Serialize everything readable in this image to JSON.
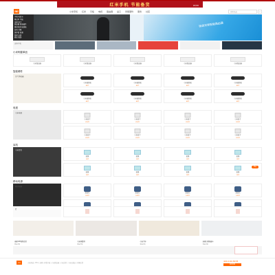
{
  "top": {
    "promo_title": "红米手机 节能备货",
    "promo_sub": "限时抢购"
  },
  "header": {
    "logo": "mi",
    "nav": [
      "小米手机",
      "红米",
      "平板",
      "电视",
      "路由器",
      "盒子",
      "智能硬件",
      "服务",
      "社区"
    ],
    "search_placeholder": "搜索商品",
    "search_icon": "search-icon"
  },
  "hero": {
    "categories": [
      "手机 电话卡",
      "笔记本 平板",
      "电视 盒子",
      "路由器 智能硬件",
      "移动电源 插线板",
      "耳机 音箱",
      "保护套 贴膜",
      "线材 支架",
      "箱包 服饰",
      "生活 周边"
    ],
    "banner_text": "极速双频智能路由器"
  },
  "subbanners": [
    "选购手机",
    "企业团购",
    "以旧换新",
    "F码通道",
    "小米移动",
    "话费充值"
  ],
  "sections": [
    {
      "title": "小米明星单品",
      "captions": [
        "小米路由器",
        "小米路由器",
        "小米路由器",
        "小米路由器",
        "小米路由器"
      ]
    },
    {
      "title": "智能硬件",
      "feature": "空气净化器",
      "captions": [
        "小米插线板",
        "小米插线板",
        "小米插线板",
        "小米插线板",
        "小米插线板",
        "小米插线板",
        "小米插线板",
        "小米插线板"
      ],
      "price": "49元"
    },
    {
      "title": "电视",
      "feature": "小米电视",
      "captions": [
        "小米盒子",
        "小米盒子",
        "小米盒子",
        "小米盒子",
        "小米盒子",
        "小米盒子",
        "小米盒子",
        "小米盒子"
      ],
      "price": "299元"
    },
    {
      "title": "耳机",
      "feature": "小米耳机",
      "captions": [
        "贴膜",
        "贴膜",
        "贴膜",
        "贴膜",
        "贴膜",
        "贴膜",
        "贴膜",
        "贴膜"
      ],
      "price": "19元",
      "badge": "新品"
    },
    {
      "title": "移动电源",
      "feature": "移动电源",
      "captions": [
        "双肩包",
        "双肩包",
        "双肩包",
        "双肩包",
        "双肩包",
        "双肩包",
        "双肩包",
        "双肩包"
      ],
      "price": "149元"
    },
    {
      "title": "配件",
      "feature": "灯",
      "captions": [
        "台灯",
        "台灯",
        "台灯",
        "台灯",
        "台灯",
        "台灯",
        "台灯",
        "台灯"
      ],
      "price": "169元"
    }
  ],
  "footer_cards": [
    {
      "title": "米家LED智能台灯",
      "sub": "查看详情"
    },
    {
      "title": "小米体重秤",
      "sub": "查看详情"
    },
    {
      "title": "小米手环",
      "sub": "查看详情"
    },
    {
      "title": "米家扫地机器人",
      "sub": "查看详情"
    }
  ],
  "footer": {
    "text": "小米商城 | MIUI | 米聊 | 多看书城 | 小米路由器 | 小米后院 | 小米天猫店 | 问题反馈",
    "phone": "400-100-5678",
    "contact": "联系客服"
  },
  "colors": {
    "accent": "#ff6700",
    "promo_bg": "#b0111a"
  }
}
